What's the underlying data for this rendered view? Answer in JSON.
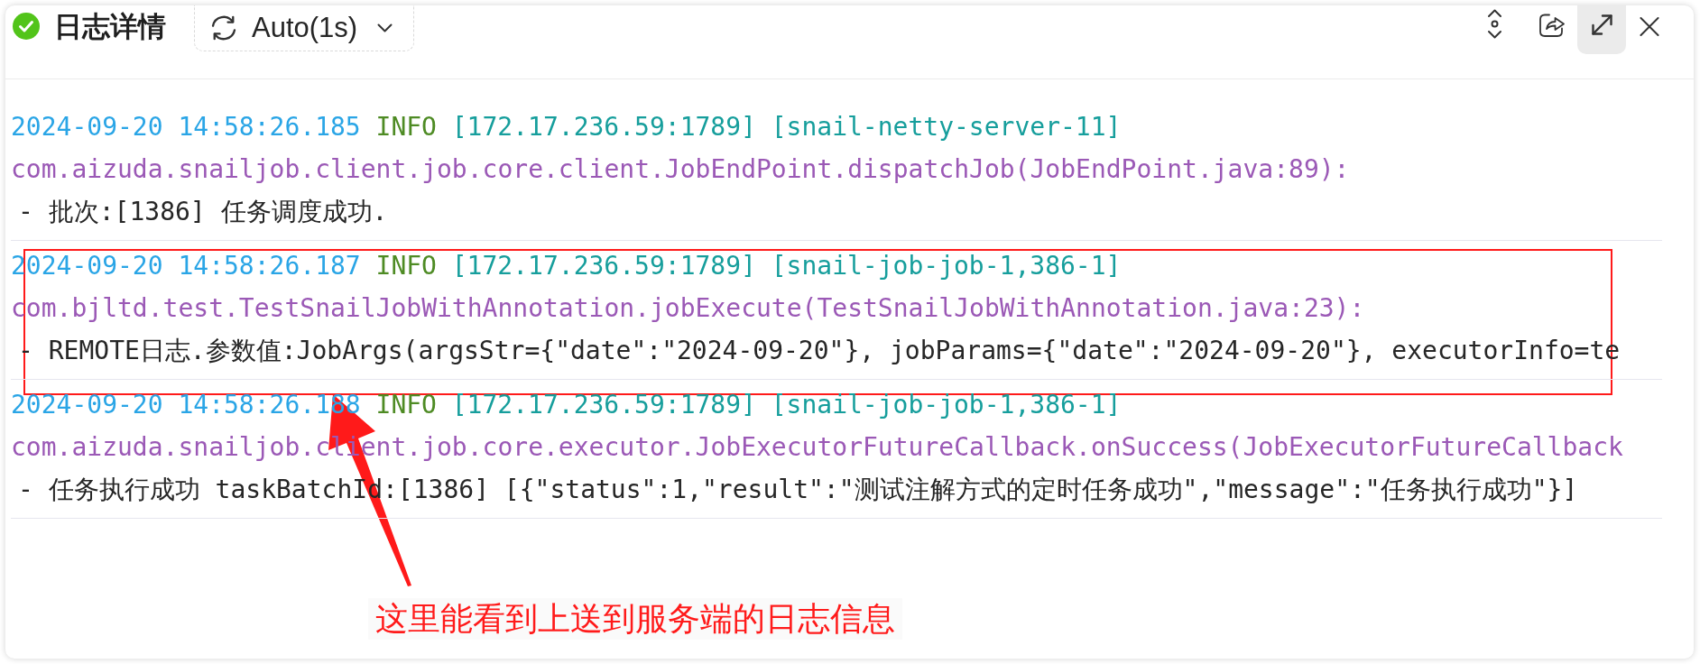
{
  "header": {
    "status": {
      "kind": "success"
    },
    "title": "日志详情",
    "refresh_interval": "Auto(1s)",
    "expand_active": true
  },
  "entries": [
    {
      "time": "2024-09-20 14:58:26.185",
      "log_level": "INFO",
      "host": "[172.17.236.59:1789]",
      "thread": "[snail-netty-server-11]",
      "location": "com.aizuda.snailjob.client.job.core.client.JobEndPoint.dispatchJob(JobEndPoint.java:89):",
      "message": "- 批次:[1386] 任务调度成功."
    },
    {
      "time": "2024-09-20 14:58:26.187",
      "log_level": "INFO",
      "host": "[172.17.236.59:1789]",
      "thread": "[snail-job-job-1,386-1]",
      "location": "com.bjltd.test.TestSnailJobWithAnnotation.jobExecute(TestSnailJobWithAnnotation.java:23):",
      "message": "- REMOTE日志.参数值:JobArgs(argsStr={\"date\":\"2024-09-20\"}, jobParams={\"date\":\"2024-09-20\"}, executorInfo=te"
    },
    {
      "time": "2024-09-20 14:58:26.188",
      "log_level": "INFO",
      "host": "[172.17.236.59:1789]",
      "thread": "[snail-job-job-1,386-1]",
      "location": "com.aizuda.snailjob.client.job.core.executor.JobExecutorFutureCallback.onSuccess(JobExecutorFutureCallback",
      "message": "- 任务执行成功 taskBatchId:[1386] [{\"status\":1,\"result\":\"测试注解方式的定时任务成功\",\"message\":\"任务执行成功\"}]"
    }
  ],
  "annotation": {
    "label": "这里能看到上送到服务端的日志信息"
  }
}
